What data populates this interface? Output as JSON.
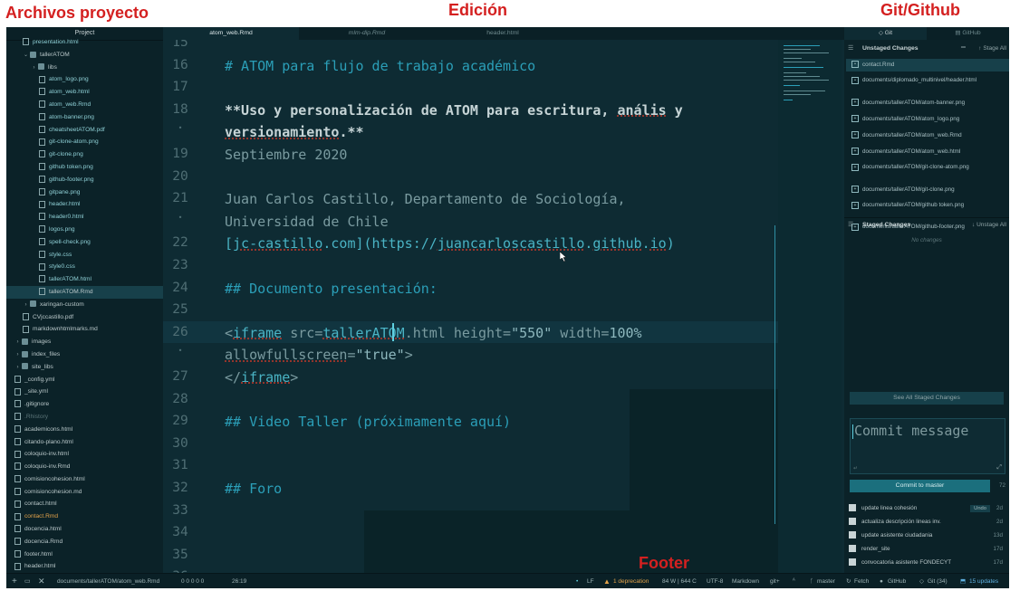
{
  "annotations": {
    "left": "Archivos proyecto",
    "center": "Edición",
    "right": "Git/Github",
    "footer": "Footer"
  },
  "tree": {
    "header": "Project",
    "items": [
      {
        "label": "presentation.html",
        "type": "file",
        "indent": 2
      },
      {
        "label": "tallerATOM",
        "type": "folder-open",
        "indent": 2
      },
      {
        "label": "libs",
        "type": "folder",
        "indent": 3
      },
      {
        "label": "atom_logo.png",
        "type": "file",
        "indent": 4
      },
      {
        "label": "atom_web.html",
        "type": "file",
        "indent": 4
      },
      {
        "label": "atom_web.Rmd",
        "type": "file",
        "indent": 4
      },
      {
        "label": "atom-banner.png",
        "type": "file",
        "indent": 4
      },
      {
        "label": "cheatsheetATOM.pdf",
        "type": "file",
        "indent": 4
      },
      {
        "label": "git-clone-atom.png",
        "type": "file",
        "indent": 4
      },
      {
        "label": "git-clone.png",
        "type": "file",
        "indent": 4
      },
      {
        "label": "github token.png",
        "type": "file",
        "indent": 4
      },
      {
        "label": "github-footer.png",
        "type": "file",
        "indent": 4
      },
      {
        "label": "gitpane.png",
        "type": "file",
        "indent": 4
      },
      {
        "label": "header.html",
        "type": "file",
        "indent": 4
      },
      {
        "label": "header0.html",
        "type": "file",
        "indent": 4
      },
      {
        "label": "logos.png",
        "type": "file",
        "indent": 4
      },
      {
        "label": "spell-check.png",
        "type": "file",
        "indent": 4
      },
      {
        "label": "style.css",
        "type": "file",
        "indent": 4
      },
      {
        "label": "style0.css",
        "type": "file",
        "indent": 4
      },
      {
        "label": "tallerATOM.html",
        "type": "file",
        "indent": 4
      },
      {
        "label": "tallerATOM.Rmd",
        "type": "file-plain",
        "indent": 4
      },
      {
        "label": "xaringan-custom",
        "type": "folder",
        "indent": 2
      },
      {
        "label": "CVjccastillo.pdf",
        "type": "file-plain",
        "indent": 2
      },
      {
        "label": "markdownhtmlmarks.md",
        "type": "file-plain",
        "indent": 2
      },
      {
        "label": "images",
        "type": "folder",
        "indent": 1
      },
      {
        "label": "index_files",
        "type": "folder",
        "indent": 1
      },
      {
        "label": "site_libs",
        "type": "folder",
        "indent": 1
      },
      {
        "label": "_config.yml",
        "type": "file-plain",
        "indent": 1
      },
      {
        "label": "_site.yml",
        "type": "file-plain",
        "indent": 1
      },
      {
        "label": ".gitignore",
        "type": "file-plain",
        "indent": 1
      },
      {
        "label": ".Rhistory",
        "type": "file-dim",
        "indent": 1
      },
      {
        "label": "academicons.html",
        "type": "file-plain",
        "indent": 1
      },
      {
        "label": "citando-plano.html",
        "type": "file-plain",
        "indent": 1
      },
      {
        "label": "coloquio-inv.html",
        "type": "file-plain",
        "indent": 1
      },
      {
        "label": "coloquio-inv.Rmd",
        "type": "file-plain",
        "indent": 1
      },
      {
        "label": "comisioncohesion.html",
        "type": "file-plain",
        "indent": 1
      },
      {
        "label": "comisioncohesion.md",
        "type": "file-plain",
        "indent": 1
      },
      {
        "label": "contact.html",
        "type": "file-plain",
        "indent": 1
      },
      {
        "label": "contact.Rmd",
        "type": "file-orange",
        "indent": 1
      },
      {
        "label": "docencia.html",
        "type": "file-plain",
        "indent": 1
      },
      {
        "label": "docencia.Rmd",
        "type": "file-plain",
        "indent": 1
      },
      {
        "label": "footer.html",
        "type": "file-plain",
        "indent": 1
      },
      {
        "label": "header.html",
        "type": "file-plain",
        "indent": 1
      }
    ]
  },
  "tabs": [
    {
      "label": "atom_web.Rmd",
      "active": true
    },
    {
      "label": "mlm-dip.Rmd",
      "active": false
    },
    {
      "label": "header.html",
      "active": false
    }
  ],
  "editor": {
    "lines": [
      {
        "n": "15",
        "parts": []
      },
      {
        "n": "16",
        "parts": [
          {
            "t": "# ATOM para flujo de trabajo académico",
            "c": "c-h"
          }
        ]
      },
      {
        "n": "17",
        "parts": []
      },
      {
        "n": "18",
        "parts": [
          {
            "t": "**Uso y personalización de ATOM para escritura, ",
            "c": "c-b"
          },
          {
            "t": "anális",
            "c": "c-b sq"
          },
          {
            "t": " y",
            "c": "c-b"
          }
        ]
      },
      {
        "n": "•",
        "parts": [
          {
            "t": "versionamiento",
            "c": "c-b sq"
          },
          {
            "t": ".**",
            "c": "c-b"
          }
        ]
      },
      {
        "n": "19",
        "parts": [
          {
            "t": "Septiembre 2020",
            "c": "c-p"
          }
        ]
      },
      {
        "n": "20",
        "parts": []
      },
      {
        "n": "21",
        "parts": [
          {
            "t": "Juan Carlos Castillo, Departamento de Sociología,",
            "c": "c-p"
          }
        ]
      },
      {
        "n": "•",
        "parts": [
          {
            "t": "Universidad de Chile",
            "c": "c-p"
          }
        ]
      },
      {
        "n": "22",
        "parts": [
          {
            "t": "[",
            "c": "c-t"
          },
          {
            "t": "jc-castillo",
            "c": "c-t sq"
          },
          {
            "t": ".com](https://",
            "c": "c-t"
          },
          {
            "t": "juancarloscastillo",
            "c": "c-t sq"
          },
          {
            "t": ".",
            "c": "c-t"
          },
          {
            "t": "github",
            "c": "c-t sq"
          },
          {
            "t": ".",
            "c": "c-t"
          },
          {
            "t": "io",
            "c": "c-t sq"
          },
          {
            "t": ")",
            "c": "c-t"
          }
        ]
      },
      {
        "n": "23",
        "parts": []
      },
      {
        "n": "24",
        "parts": [
          {
            "t": "## Documento presentación:",
            "c": "c-h"
          }
        ]
      },
      {
        "n": "25",
        "parts": []
      },
      {
        "n": "26",
        "parts": [
          {
            "t": "<",
            "c": "c-p"
          },
          {
            "t": "iframe",
            "c": "c-t sq"
          },
          {
            "t": " src=",
            "c": "c-p"
          },
          {
            "t": "tallerATOM",
            "c": "c-t sq"
          },
          {
            "t": ".html height=",
            "c": "c-p"
          },
          {
            "t": "\"550\"",
            "c": "c-s"
          },
          {
            "t": " width=",
            "c": "c-p"
          },
          {
            "t": "100%",
            "c": "c-s"
          }
        ]
      },
      {
        "n": "•",
        "parts": [
          {
            "t": "allowfullscreen",
            "c": "c-p sq"
          },
          {
            "t": "=",
            "c": "c-p"
          },
          {
            "t": "\"true\"",
            "c": "c-s"
          },
          {
            "t": ">",
            "c": "c-p"
          }
        ]
      },
      {
        "n": "27",
        "parts": [
          {
            "t": "</",
            "c": "c-p"
          },
          {
            "t": "iframe",
            "c": "c-t sq"
          },
          {
            "t": ">",
            "c": "c-p"
          }
        ]
      },
      {
        "n": "28",
        "parts": []
      },
      {
        "n": "29",
        "parts": [
          {
            "t": "## Video Taller (próximamente aquí)",
            "c": "c-h"
          }
        ]
      },
      {
        "n": "30",
        "parts": []
      },
      {
        "n": "31",
        "parts": []
      },
      {
        "n": "32",
        "parts": [
          {
            "t": "## Foro",
            "c": "c-h"
          }
        ]
      },
      {
        "n": "33",
        "parts": []
      },
      {
        "n": "34",
        "parts": []
      },
      {
        "n": "35",
        "parts": []
      },
      {
        "n": "36",
        "parts": []
      }
    ]
  },
  "git": {
    "tab_git": "Git",
    "tab_github": "GitHub",
    "unstaged_title": "Unstaged Changes",
    "stage_all": "Stage All",
    "unstaged": [
      "contact.Rmd",
      "documents/diplomado_multinivel/header.html",
      "documents/tallerATOM/atom-banner.png",
      "documents/tallerATOM/atom_logo.png",
      "documents/tallerATOM/atom_web.Rmd",
      "documents/tallerATOM/atom_web.html",
      "documents/tallerATOM/git-clone-atom.png",
      "documents/tallerATOM/git-clone.png",
      "documents/tallerATOM/github token.png",
      "documents/tallerATOM/github-footer.png"
    ],
    "staged_title": "Staged Changes",
    "unstage_all": "Unstage All",
    "no_changes": "No changes",
    "see_all": "See All Staged Changes",
    "commit_placeholder": "Commit message",
    "commit_button": "Commit to master",
    "char_count": "72",
    "undo": "Undo",
    "commits": [
      {
        "msg": "update linea cohesión",
        "when": "2d"
      },
      {
        "msg": "actualiza descripción lineas inv.",
        "when": "2d"
      },
      {
        "msg": "update asistente ciudadania",
        "when": "13d"
      },
      {
        "msg": "render_site",
        "when": "17d"
      },
      {
        "msg": "convocatoria asistente FONDECYT",
        "when": "17d"
      }
    ]
  },
  "status": {
    "path": "documents/tallerATOM/atom_web.Rmd",
    "counts": "0 0  0 0  0",
    "cursor": "26:19",
    "line_ending": "LF",
    "deprecation": "1 deprecation",
    "words": "84 W | 644 C",
    "encoding": "UTF-8",
    "grammar": "Markdown",
    "git_plus": "git+",
    "branch": "master",
    "fetch": "Fetch",
    "github": "GitHub",
    "git_count": "Git (34)",
    "updates": "15 updates"
  }
}
